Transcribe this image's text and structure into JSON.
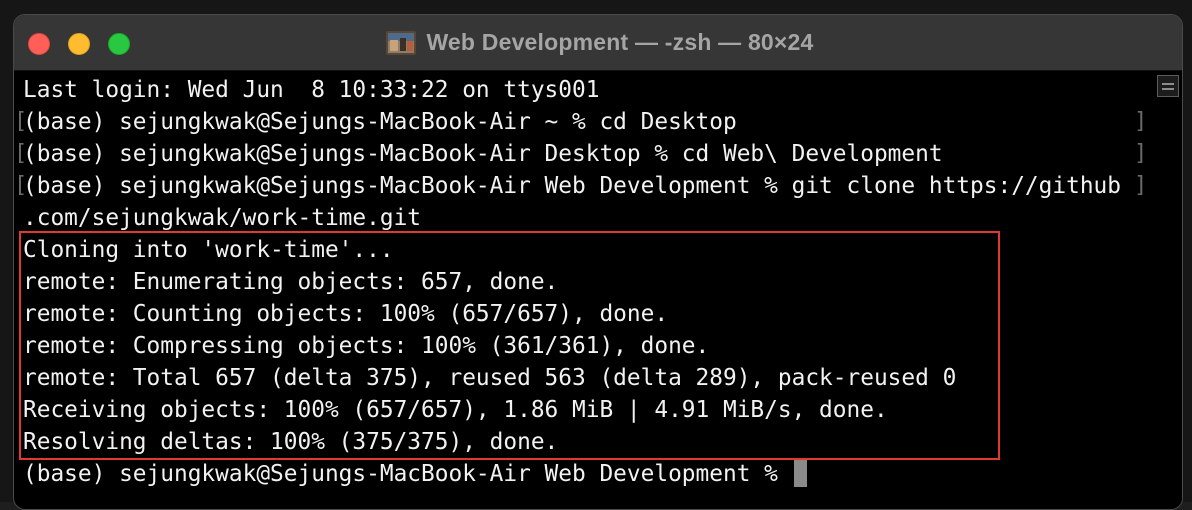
{
  "window": {
    "title": "Web Development — -zsh — 80×24",
    "title_icon": "folder-icon"
  },
  "terminal": {
    "lines": [
      {
        "text": "Last login: Wed Jun  8 10:33:22 on ttys001",
        "marked": false
      },
      {
        "text": "(base) sejungkwak@Sejungs-MacBook-Air ~ % cd Desktop",
        "marked": true
      },
      {
        "text": "(base) sejungkwak@Sejungs-MacBook-Air Desktop % cd Web\\ Development",
        "marked": true
      },
      {
        "text": "(base) sejungkwak@Sejungs-MacBook-Air Web Development % git clone https://github",
        "marked": true
      },
      {
        "text": ".com/sejungkwak/work-time.git",
        "marked": false
      },
      {
        "text": "Cloning into 'work-time'...",
        "marked": false
      },
      {
        "text": "remote: Enumerating objects: 657, done.",
        "marked": false
      },
      {
        "text": "remote: Counting objects: 100% (657/657), done.",
        "marked": false
      },
      {
        "text": "remote: Compressing objects: 100% (361/361), done.",
        "marked": false
      },
      {
        "text": "remote: Total 657 (delta 375), reused 563 (delta 289), pack-reused 0",
        "marked": false
      },
      {
        "text": "Receiving objects: 100% (657/657), 1.86 MiB | 4.91 MiB/s, done.",
        "marked": false
      },
      {
        "text": "Resolving deltas: 100% (375/375), done.",
        "marked": false
      },
      {
        "text": "(base) sejungkwak@Sejungs-MacBook-Air Web Development % ",
        "marked": false,
        "cursor": true
      }
    ]
  },
  "colors": {
    "highlight_border": "#e03a2f",
    "terminal_bg": "#000000",
    "terminal_fg": "#f2f2f2",
    "titlebar_bg": "#363636"
  }
}
